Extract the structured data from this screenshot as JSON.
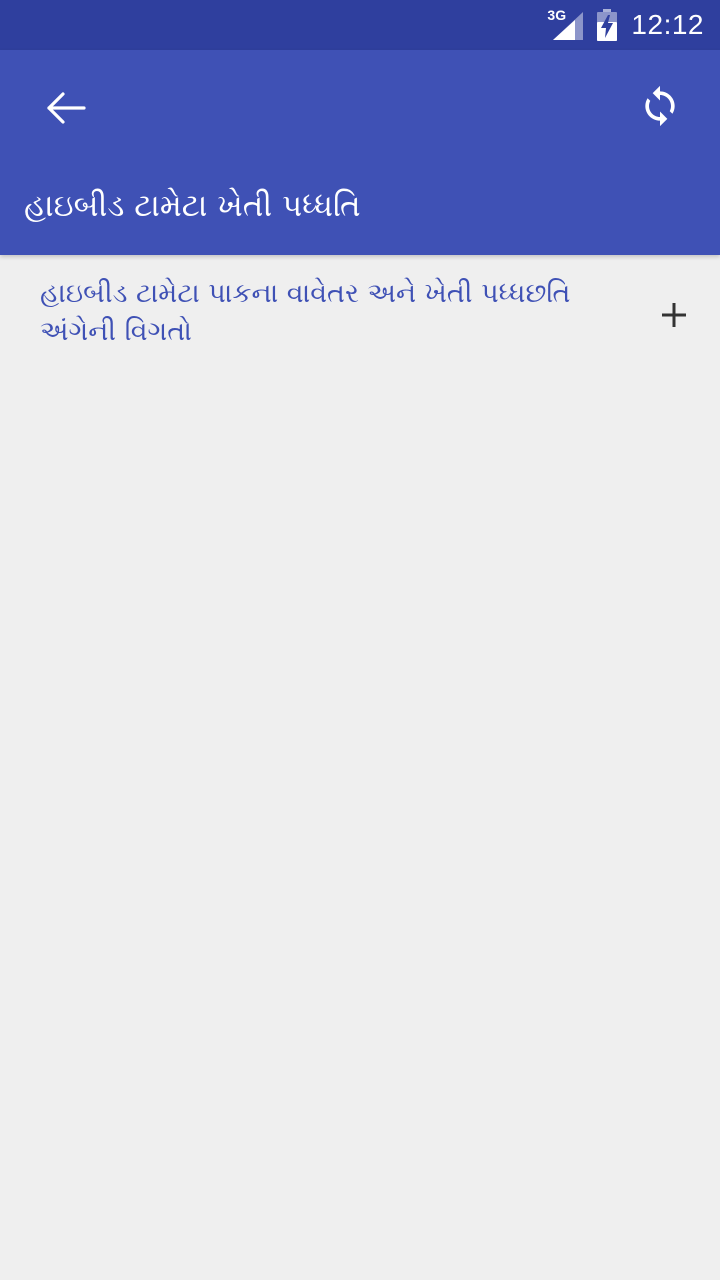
{
  "status_bar": {
    "network_type": "3G",
    "time": "12:12",
    "icons": [
      "signal-icon",
      "battery-charging-icon"
    ]
  },
  "app_bar": {
    "icons": [
      "back-arrow-icon",
      "refresh-icon"
    ],
    "title": "હાઇબીડ ટામેટા ખેતી પધ્ધતિ"
  },
  "content": {
    "items": [
      {
        "label": "હાઇબીડ ટામેટા પાકના વાવેતર અને ખેતી પધ્ધછતિ અંગેની વિગતો",
        "icon": "plus-icon"
      }
    ]
  },
  "colors": {
    "status_bar": "#2f3f9e",
    "app_bar": "#3f51b5",
    "background": "#efefef",
    "item_text": "#3f51b5",
    "icon_dark": "#333333"
  }
}
